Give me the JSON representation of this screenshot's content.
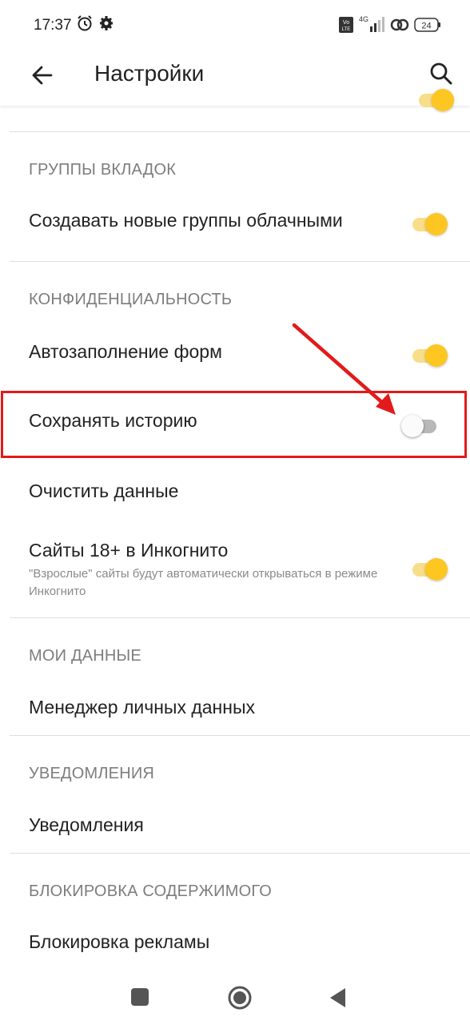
{
  "status_bar": {
    "time": "17:37",
    "icons": [
      "alarm-icon",
      "gear-icon",
      "volte-icon",
      "signal-4g-icon",
      "link-icon"
    ],
    "network": "4G",
    "battery": "24"
  },
  "app_bar": {
    "title": "Настройки",
    "back_icon": "arrow-left-icon",
    "search_icon": "search-icon"
  },
  "sections": {
    "tab_groups": {
      "header": "ГРУППЫ ВКЛАДОК",
      "items": [
        {
          "label": "Создавать новые группы облачными",
          "toggle": true
        }
      ]
    },
    "privacy": {
      "header": "КОНФИДЕНЦИАЛЬНОСТЬ",
      "items": [
        {
          "label": "Автозаполнение форм",
          "toggle": true
        },
        {
          "label": "Сохранять историю",
          "toggle": false
        },
        {
          "label": "Очистить данные"
        },
        {
          "label": "Сайты 18+ в Инкогнито",
          "sublabel": "\"Взрослые\" сайты будут автоматически открываться в режиме Инкогнито",
          "toggle": true
        }
      ]
    },
    "my_data": {
      "header": "МОИ ДАННЫЕ",
      "items": [
        {
          "label": "Менеджер личных данных"
        }
      ]
    },
    "notifications": {
      "header": "УВЕДОМЛЕНИЯ",
      "items": [
        {
          "label": "Уведомления"
        }
      ]
    },
    "content_blocking": {
      "header": "БЛОКИРОВКА СОДЕРЖИМОГО",
      "items": [
        {
          "label": "Блокировка рекламы"
        }
      ]
    }
  },
  "nav_bar": {
    "buttons": [
      "recent-apps-icon",
      "home-icon",
      "back-triangle-icon"
    ]
  },
  "colors": {
    "toggle_on_thumb": "#fdc621",
    "toggle_on_track": "#f8de8a",
    "toggle_off_track": "#b8b8b8",
    "annotation_red": "#e31a1a"
  }
}
